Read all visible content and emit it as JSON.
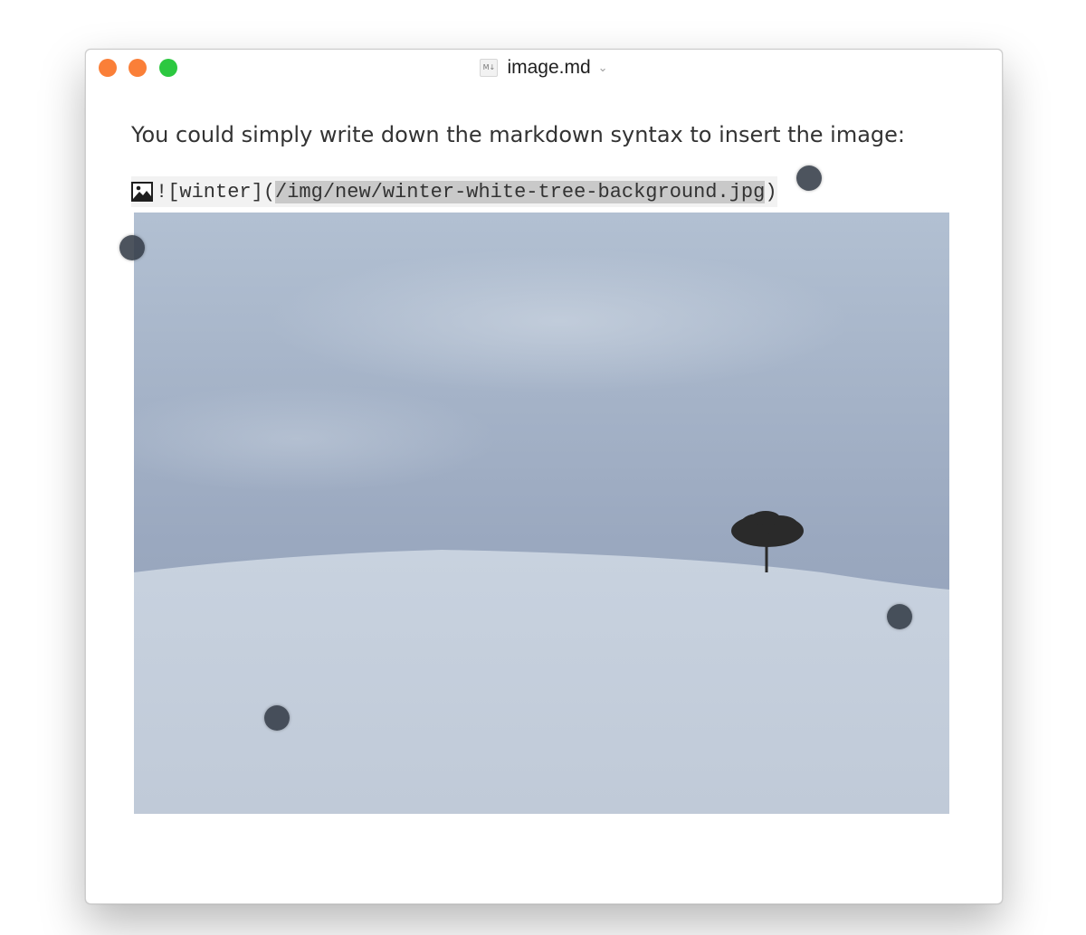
{
  "window": {
    "title": "image.md",
    "file_icon": "markdown-file-icon",
    "title_menu_icon": "chevron-down-icon",
    "traffic_lights": {
      "close": "#fa7f38",
      "minimize": "#fa7f38",
      "maximize": "#2cc840"
    }
  },
  "editor": {
    "paragraph": "You could simply write down the markdown syntax to insert the image:",
    "markdown": {
      "icon": "image-icon",
      "prefix": "![winter](",
      "selected_path": "/img/new/winter-white-tree-background.jpg",
      "suffix": ")"
    },
    "image": {
      "alt": "winter",
      "description_icon": "winter-photo"
    }
  },
  "colors": {
    "sky": "#9aa9c1",
    "snow": "#c3cddb",
    "selection": "#c9c9c9",
    "code_background": "#f2f2f2"
  }
}
